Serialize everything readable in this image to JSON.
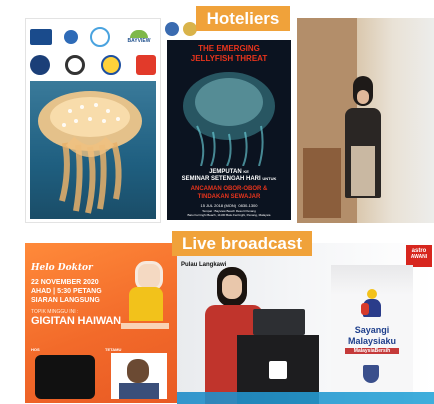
{
  "labels": {
    "hoteliers": "Hoteliers",
    "live": "Live broadcast"
  },
  "poster_jellyfish": {
    "logos": [
      "unesco-logo",
      "sibling-logo",
      "bayview-logo",
      "seal-logo-1",
      "seal-logo-2",
      "seal-logo-3",
      "seal-logo-4"
    ],
    "bayview_text": "BAYVIEW"
  },
  "poster_threat": {
    "title_line1": "THE EMERGING",
    "title_line2": "JELLYFISH THREAT",
    "invite": "JEMPUTAN",
    "invite_suffix": "KE",
    "seminar": "SEMINAR SETENGAH HARI",
    "seminar_suffix": "UNTUK",
    "topic_line1": "ANCAMAN OBOR-OBOR &",
    "topic_line2": "TINDAKAN SEWAJAR",
    "date": "15 JUL 2018 (MON)",
    "time": "0830-1300",
    "venue_line1": "Tempat : Bayview Beach Resort Penang",
    "venue_line2": "Batu Ferringhi Beach, 11100 Batu Ferringhi, Penang, Malaysia"
  },
  "tv_poster": {
    "show": "Helo Doktor",
    "date": "22 NOVEMBER 2020",
    "day_time": "AHAD | 5:30 PETANG",
    "broadcast": "SIARAN LANGSUNG",
    "topic_label": "TOPIK MINGGU INI :",
    "topic": "GIGITAN HAIWAN",
    "host_tag": "HOS",
    "guest_tag": "TETAMU"
  },
  "broadcast": {
    "location": "Pulau Langkawi",
    "channel": "astro",
    "channel_sub": "AWANI",
    "banner_line1": "Sayangi",
    "banner_line2": "Malaysiaku",
    "banner_line3": "MalaysiaBersih"
  },
  "colors": {
    "label_bg": "#f0a23a",
    "threat_title": "#e8341c",
    "tv_orange": "#f26a2a",
    "awani_red": "#d7261e",
    "teal_bar": "#1f8cc8"
  }
}
